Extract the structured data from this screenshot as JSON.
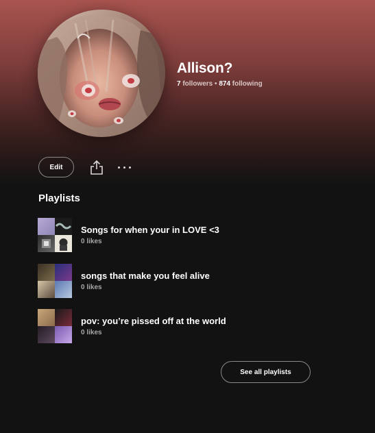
{
  "profile": {
    "name": "Allison?",
    "followers_count": "7",
    "followers_label": "followers",
    "separator": "•",
    "following_count": "874",
    "following_label": "following"
  },
  "actions": {
    "edit_label": "Edit",
    "share_icon": "share-icon",
    "more_icon": "more-options-icon"
  },
  "playlists_section": {
    "title": "Playlists",
    "items": [
      {
        "title": "Songs for when your in LOVE <3",
        "likes": "0 likes"
      },
      {
        "title": "songs that make you feel alive",
        "likes": "0 likes"
      },
      {
        "title": "pov: you’re pissed off at the world",
        "likes": "0 likes"
      }
    ],
    "see_all_label": "See all playlists"
  },
  "colors": {
    "header_gradient_top": "#a9544f",
    "background": "#121212",
    "text_primary": "#ffffff",
    "text_secondary": "#a7a7a7"
  }
}
